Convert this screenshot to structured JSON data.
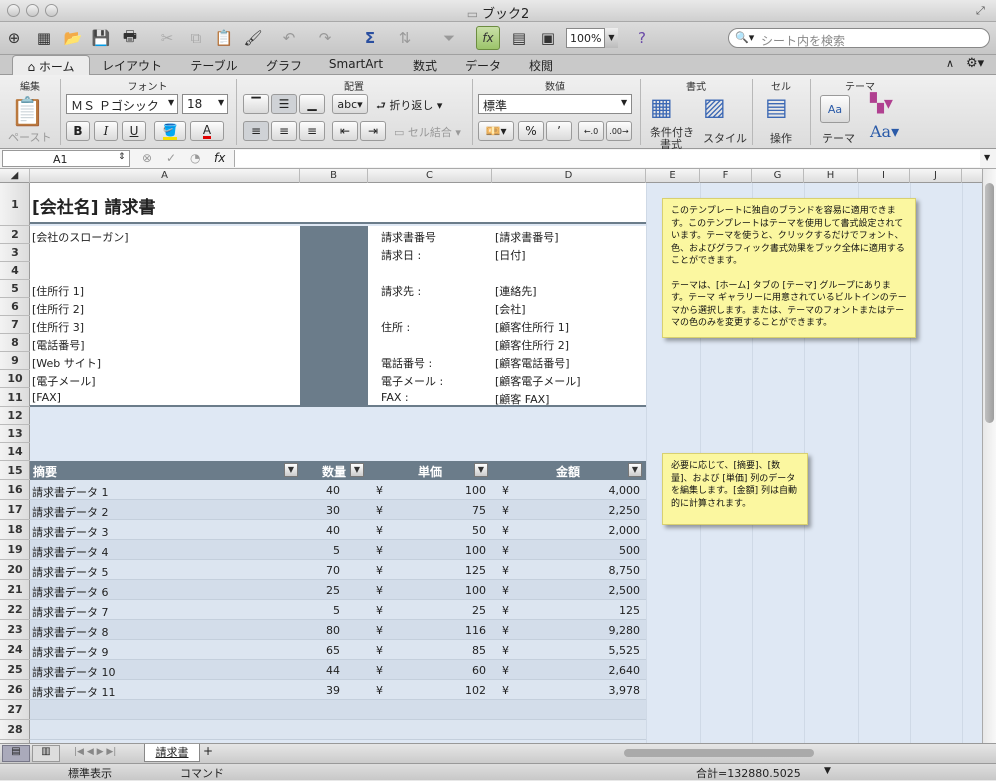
{
  "window": {
    "title": "ブック2"
  },
  "toolbar": {
    "zoom": "100%",
    "search_placeholder": "シート内を検索"
  },
  "tabs": [
    "ホーム",
    "レイアウト",
    "テーブル",
    "グラフ",
    "SmartArt",
    "数式",
    "データ",
    "校閲"
  ],
  "ribbon": {
    "groups": {
      "edit": "編集",
      "font": "フォント",
      "align": "配置",
      "number": "数値",
      "format": "書式",
      "cell": "セル",
      "theme": "テーマ"
    },
    "paste_label": "ペースト",
    "font_name": "ＭＳ Ｐゴシック",
    "font_size": "18",
    "bold": "B",
    "italic": "I",
    "underline": "U",
    "abc": "abc",
    "wrap_label": "折り返し",
    "merge_label": "セル結合",
    "number_format": "標準",
    "percent": "%",
    "comma": "ʼ",
    "cond_format_l1": "条件付き",
    "cond_format_l2": "書式",
    "style_label": "スタイル",
    "ops_label": "操作",
    "theme_label": "テーマ",
    "aa_label": "Aa"
  },
  "formula_bar": {
    "cell": "A1",
    "fx": "fx",
    "value": ""
  },
  "columns": [
    "A",
    "B",
    "C",
    "D",
    "E",
    "F",
    "G",
    "H",
    "I",
    "J"
  ],
  "rows": [
    "1",
    "2",
    "3",
    "4",
    "5",
    "6",
    "7",
    "8",
    "9",
    "10",
    "11",
    "12",
    "13",
    "14",
    "15",
    "16",
    "17",
    "18",
    "19",
    "20",
    "21",
    "22",
    "23",
    "24",
    "25",
    "26",
    "27",
    "28"
  ],
  "invoice": {
    "title": "[会社名] 請求書",
    "left": [
      "[会社のスローガン]",
      "",
      "",
      "[住所行 1]",
      "[住所行 2]",
      "[住所行 3]",
      "[電話番号]",
      "[Web サイト]",
      "[電子メール]",
      "[FAX]"
    ],
    "labels": [
      "請求書番号",
      "請求日 :",
      "",
      "請求先 :",
      "",
      "住所 :",
      "",
      "電話番号 :",
      "電子メール :",
      "FAX :"
    ],
    "values": [
      "[請求書番号]",
      "[日付]",
      "",
      "[連絡先]",
      "[会社]",
      "[顧客住所行 1]",
      "[顧客住所行 2]",
      "[顧客電話番号]",
      "[顧客電子メール]",
      "[顧客 FAX]"
    ]
  },
  "table": {
    "headers": [
      "摘要",
      "数量",
      "単価",
      "金額"
    ],
    "currency": "¥",
    "rows": [
      {
        "desc": "請求書データ 1",
        "qty": "40",
        "price": "100",
        "amount": "4,000"
      },
      {
        "desc": "請求書データ 2",
        "qty": "30",
        "price": "75",
        "amount": "2,250"
      },
      {
        "desc": "請求書データ 3",
        "qty": "40",
        "price": "50",
        "amount": "2,000"
      },
      {
        "desc": "請求書データ 4",
        "qty": "5",
        "price": "100",
        "amount": "500"
      },
      {
        "desc": "請求書データ 5",
        "qty": "70",
        "price": "125",
        "amount": "8,750"
      },
      {
        "desc": "請求書データ 6",
        "qty": "25",
        "price": "100",
        "amount": "2,500"
      },
      {
        "desc": "請求書データ 7",
        "qty": "5",
        "price": "25",
        "amount": "125"
      },
      {
        "desc": "請求書データ 8",
        "qty": "80",
        "price": "116",
        "amount": "9,280"
      },
      {
        "desc": "請求書データ 9",
        "qty": "65",
        "price": "85",
        "amount": "5,525"
      },
      {
        "desc": "請求書データ 10",
        "qty": "44",
        "price": "60",
        "amount": "2,640"
      },
      {
        "desc": "請求書データ 11",
        "qty": "39",
        "price": "102",
        "amount": "3,978"
      }
    ]
  },
  "notes": {
    "note1": "このテンプレートに独自のブランドを容易に適用できます。このテンプレートはテーマを使用して書式設定されています。テーマを使うと、クリックするだけでフォント、色、およびグラフィック書式効果をブック全体に適用することができます。",
    "note1b": "テーマは、[ホーム] タブの [テーマ] グループにあります。テーマ ギャラリーに用意されているビルトインのテーマから選択します。または、テーマのフォントまたはテーマの色のみを変更することができます。",
    "note2": "必要に応じて、[摘要]、[数量]、および [単価] 列のデータを編集します。[金額] 列は自動的に計算されます。"
  },
  "sheet_tab": "請求書",
  "add_sheet": "+",
  "status": {
    "view": "標準表示",
    "mode": "コマンド",
    "sum": "合計=132880.5025"
  }
}
